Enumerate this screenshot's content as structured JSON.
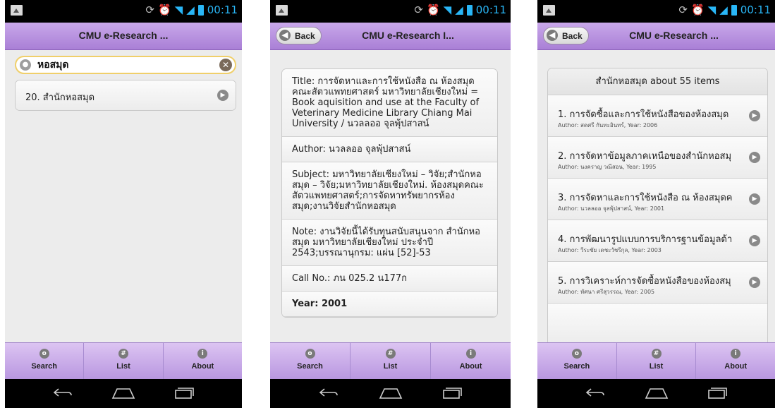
{
  "status": {
    "time": "00:11"
  },
  "tabs": [
    {
      "label": "Search",
      "icon": "search-icon"
    },
    {
      "label": "List",
      "icon": "list-icon"
    },
    {
      "label": "About",
      "icon": "info-icon"
    }
  ],
  "screen1": {
    "title": "CMU e-Research ...",
    "search_value": "หอสมุด",
    "results": [
      {
        "label": "20. สำนักหอสมุด"
      }
    ]
  },
  "screen2": {
    "title": "CMU e-Research I...",
    "back_label": "Back",
    "details": [
      "Title: การจัดหาและการใช้หนังสือ ณ ห้องสมุด คณะสัตวแพทยศาสตร์ มหาวิทยาลัยเชียงใหม่ = Book aquisition and use at the Faculty of Veterinary Medicine Library Chiang Mai University / นวลลออ จุลพุ้ปสาสน์",
      "Author: นวลลออ จุลพุ้ปสาสน์",
      "Subject: มหาวิทยาลัยเชียงใหม่ – วิจัย;สำนักหอสมุด – วิจัย;มหาวิทยาลัยเชียงใหม่. ห้องสมุดคณะสัตวแพทยศาสตร์;การจัดหาทรัพยากรห้องสมุด;งานวิจัยสำนักหอสมุด",
      "Note: งานวิจัยนี้ได้รับทุนสนับสนุนจาก สำนักหอสมุด มหาวิทยาลัยเชียงใหม่ ประจำปี 2543;บรรณานุกรม: แผ่น [52]-53",
      "Call No.: ภน 025.2 น177ก",
      "Year: 2001"
    ]
  },
  "screen3": {
    "title": "CMU e-Research ...",
    "back_label": "Back",
    "header": "สำนักหอสมุด about 55 items",
    "items": [
      {
        "title": "1. การจัดซื้อและการใช้หนังสือของห้องสมุด",
        "sub": "Author: สดศรี กันทะอินทร์, Year: 2006"
      },
      {
        "title": "2. การจัดหาข้อมูลภาคเหนือของสำนักหอสมุ",
        "sub": "Author: นงคราญ วณีสอน, Year: 1995"
      },
      {
        "title": "3. การจัดหาและการใช้หนังสือ ณ ห้องสมุดค",
        "sub": "Author: นวลลออ จุลพุ้ปสาสน์, Year: 2001"
      },
      {
        "title": "4. การพัฒนารูปแบบการบริการฐานข้อมูลด้า",
        "sub": "Author: วีระชัย เดชะวัชรีกุล, Year: 2003"
      },
      {
        "title": "5. การวิเคราะห์การจัดซื้อหนังสือของห้องสมุ",
        "sub": "Author: ทัศนา ศรีสุวรรณ, Year: 2005"
      }
    ]
  }
}
